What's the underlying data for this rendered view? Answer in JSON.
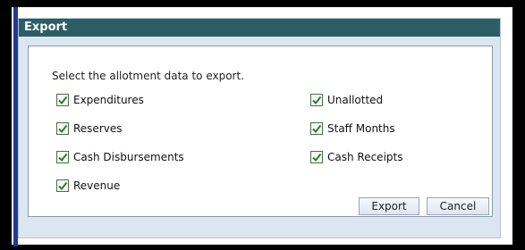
{
  "dialog": {
    "title": "Export",
    "prompt": "Select the allotment data to export.",
    "options": [
      {
        "label": "Expenditures",
        "checked": true
      },
      {
        "label": "Reserves",
        "checked": true
      },
      {
        "label": "Cash Disbursements",
        "checked": true
      },
      {
        "label": "Revenue",
        "checked": true
      },
      {
        "label": "Unallotted",
        "checked": true
      },
      {
        "label": "Staff Months",
        "checked": true
      },
      {
        "label": "Cash Receipts",
        "checked": true
      }
    ],
    "buttons": {
      "export_label": "Export",
      "cancel_label": "Cancel"
    }
  },
  "colors": {
    "title_bar": "#2c5e66",
    "dialog_bg": "#dbe6f2",
    "check_mark": "#2e7d2e"
  },
  "icons": {
    "checkbox": "checkmark-icon"
  }
}
